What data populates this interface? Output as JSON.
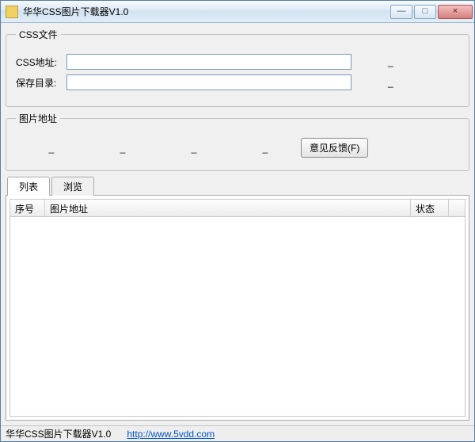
{
  "window": {
    "title": "华华CSS图片下载器V1.0",
    "min_label": "—",
    "max_label": "□",
    "close_label": "×"
  },
  "group_css": {
    "legend": "CSS文件",
    "url_label": "CSS地址:",
    "url_value": "",
    "dir_label": "保存目录:",
    "dir_value": "",
    "dash": "_"
  },
  "group_img": {
    "legend": "图片地址",
    "dash": "_",
    "feedback_btn": "意见反馈(F)"
  },
  "tabs": {
    "list": "列表",
    "preview": "浏览"
  },
  "grid": {
    "col_index": "序号",
    "col_url": "图片地址",
    "col_status": "状态",
    "rows": []
  },
  "status": {
    "left": "华华CSS图片下载器V1.0",
    "link": "http://www.5vdd.com"
  }
}
